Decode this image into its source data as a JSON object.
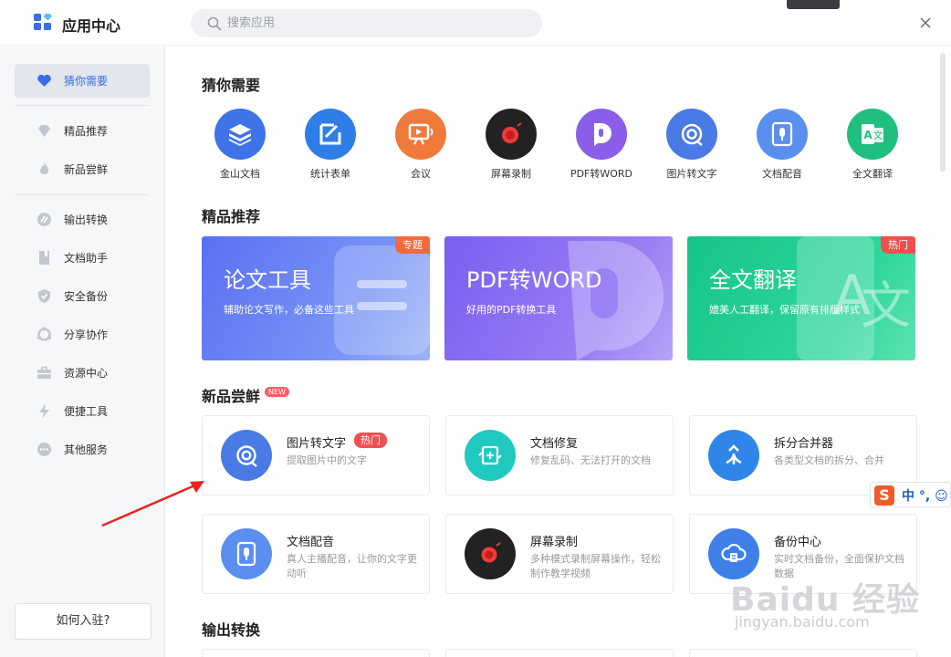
{
  "header": {
    "title": "应用中心",
    "search_placeholder": "搜索应用"
  },
  "sidebar": {
    "items": [
      {
        "label": "猜你需要",
        "icon": "heart-icon"
      },
      {
        "label": "精品推荐",
        "icon": "gem-icon"
      },
      {
        "label": "新品尝鲜",
        "icon": "flame-icon"
      },
      {
        "label": "输出转换",
        "icon": "convert-icon"
      },
      {
        "label": "文档助手",
        "icon": "document-icon"
      },
      {
        "label": "安全备份",
        "icon": "shield-icon"
      },
      {
        "label": "分享协作",
        "icon": "share-icon"
      },
      {
        "label": "资源中心",
        "icon": "briefcase-icon"
      },
      {
        "label": "便捷工具",
        "icon": "lightning-icon"
      },
      {
        "label": "其他服务",
        "icon": "more-icon"
      }
    ],
    "join_label": "如何入驻?"
  },
  "sections": {
    "guess": "猜你需要",
    "featured": "精品推荐",
    "new": "新品尝鲜",
    "new_badge": "NEW",
    "output": "输出转换"
  },
  "quick_apps": [
    {
      "label": "金山文档",
      "color": "#3f73e8"
    },
    {
      "label": "统计表单",
      "color": "#2f7ee8"
    },
    {
      "label": "会议",
      "color": "#f07a3c"
    },
    {
      "label": "屏幕录制",
      "color": "#222222"
    },
    {
      "label": "PDF转WORD",
      "color": "#8a5ee8"
    },
    {
      "label": "图片转文字",
      "color": "#4a7be4"
    },
    {
      "label": "文档配音",
      "color": "#5a8ff0"
    },
    {
      "label": "全文翻译",
      "color": "#1fbf7f"
    }
  ],
  "banners": [
    {
      "title": "论文工具",
      "subtitle": "辅助论文写作，必备这些工具",
      "tag": "专题"
    },
    {
      "title": "PDF转WORD",
      "subtitle": "好用的PDF转换工具",
      "tag": ""
    },
    {
      "title": "全文翻译",
      "subtitle": "媲美人工翻译，保留原有排版样式",
      "tag": "热门"
    }
  ],
  "cards": [
    {
      "title": "图片转文字",
      "desc": "提取图片中的文字",
      "badge": "热门"
    },
    {
      "title": "文档修复",
      "desc": "修复乱码、无法打开的文档",
      "badge": ""
    },
    {
      "title": "拆分合并器",
      "desc": "各类型文档的拆分、合并",
      "badge": ""
    },
    {
      "title": "文档配音",
      "desc": "真人主播配音，让你的文字更动听",
      "badge": ""
    },
    {
      "title": "屏幕录制",
      "desc": "多种模式录制屏幕操作，轻松制作教学视频",
      "badge": ""
    },
    {
      "title": "备份中心",
      "desc": "实时文档备份，全面保护文档数据",
      "badge": ""
    }
  ],
  "ime": {
    "logo": "S",
    "text": "中 °, ☺"
  },
  "watermark": {
    "text": "Baidu 经验",
    "url": "jingyan.baidu.com"
  }
}
